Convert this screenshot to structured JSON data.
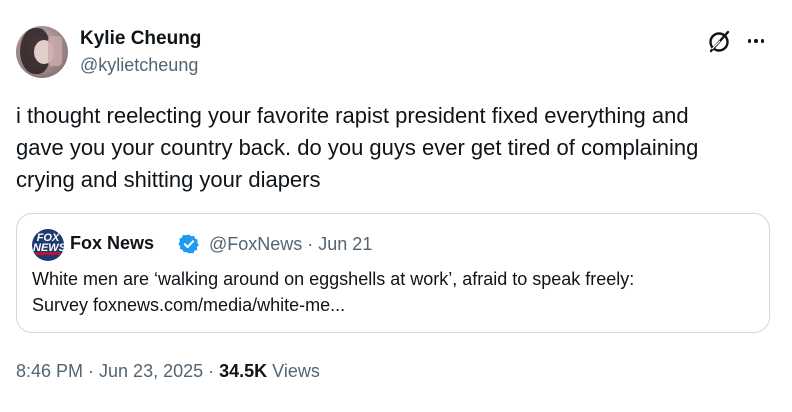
{
  "author": {
    "display_name": "Kylie Cheung",
    "handle": "@kylietcheung"
  },
  "tweet": {
    "text": "i thought reelecting your favorite rapist president fixed everything and\ngave you your country back. do you guys ever get tired of complaining\ncrying and shitting your diapers"
  },
  "quoted_tweet": {
    "author_name": "Fox News",
    "meta": "@FoxNews · Jun 21",
    "text": "White men are ‘walking around on eggshells at work’, afraid to speak freely:\nSurvey foxnews.com/media/white-me...",
    "avatar_label": "FOX NEWS"
  },
  "footer": {
    "timestamp": "8:46 PM · Jun 23, 2025 · ",
    "views_count": "34.5K",
    "views_label": " Views"
  },
  "icons": {
    "grok": "grok-icon",
    "more": "more-icon",
    "verified": "verified-badge-icon"
  },
  "colors": {
    "text_primary": "#0f1419",
    "text_secondary": "#536471",
    "verified_blue": "#1d9bf0",
    "border": "#cfd9de"
  }
}
